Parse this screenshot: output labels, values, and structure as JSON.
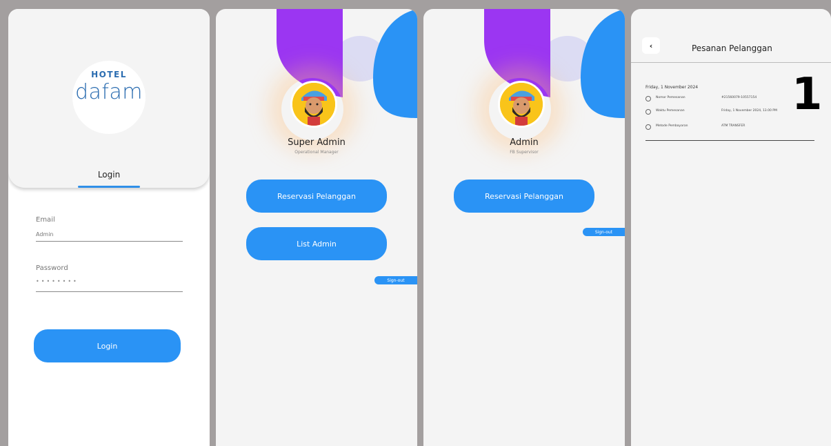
{
  "login_screen": {
    "logo_top": "HOTEL",
    "logo_bottom": "dafam",
    "tab_label": "Login",
    "email_label": "Email",
    "email_placeholder": "Admin",
    "password_label": "Password",
    "password_value": "••••••••",
    "login_button": "Login"
  },
  "super_admin_screen": {
    "name": "Super Admin",
    "role": "Operational Manager",
    "buttons": [
      "Reservasi Pelanggan",
      "List Admin"
    ],
    "signout": "Sign-out"
  },
  "admin_screen": {
    "name": "Admin",
    "role": "FB Supervisor",
    "buttons": [
      "Reservasi Pelanggan"
    ],
    "signout": "Sign-out"
  },
  "orders_screen": {
    "back_icon": "chevron-left-icon",
    "title": "Pesanan Pelanggan",
    "date": "Friday, 1 November 2024",
    "count": "1",
    "rows": [
      {
        "label": "Nomor Pemesanan",
        "value": "#21560079-10557154"
      },
      {
        "label": "Waktu Pemesanan",
        "value": "Friday, 1 November 2024, 13.00 PM"
      },
      {
        "label": "Metode Pembayaran",
        "value": "ATM TRANSFER"
      }
    ]
  },
  "colors": {
    "accent_blue": "#2a93f5",
    "purple": "#9b36f2",
    "logo_blue": "#2a6cb0",
    "background": "#a39f9f"
  }
}
